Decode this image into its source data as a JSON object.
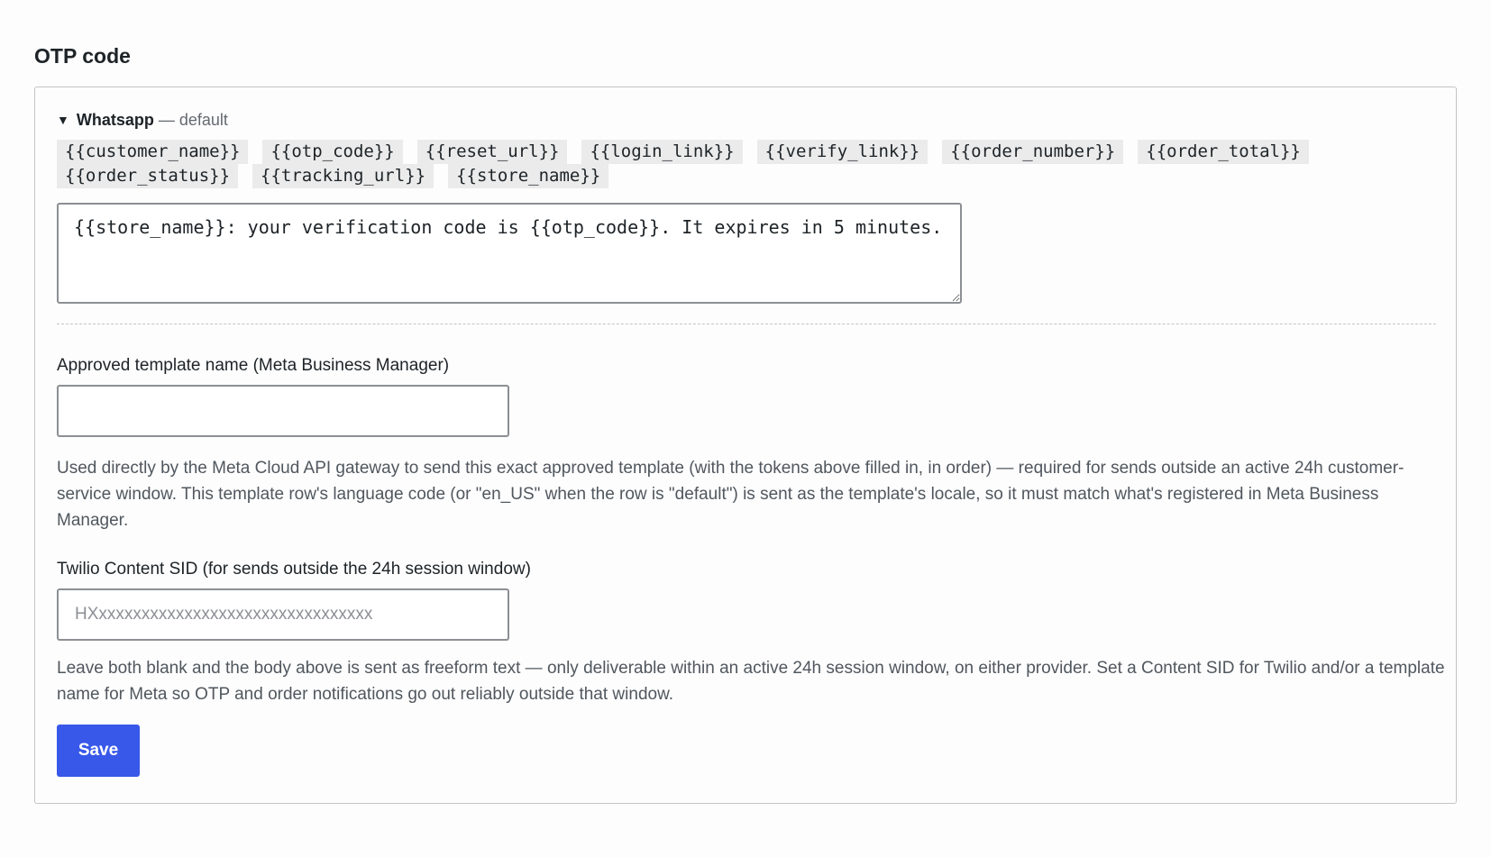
{
  "section": {
    "title": "OTP code"
  },
  "template_row": {
    "channel": "Whatsapp",
    "separator": "—",
    "locale": "default",
    "tokens": [
      "{{customer_name}}",
      "{{otp_code}}",
      "{{reset_url}}",
      "{{login_link}}",
      "{{verify_link}}",
      "{{order_number}}",
      "{{order_total}}",
      "{{order_status}}",
      "{{tracking_url}}",
      "{{store_name}}"
    ],
    "body_value": "{{store_name}}: your verification code is {{otp_code}}. It expires in 5 minutes."
  },
  "meta_template": {
    "label": "Approved template name (Meta Business Manager)",
    "value": "",
    "placeholder": "",
    "help": "Used directly by the Meta Cloud API gateway to send this exact approved template (with the tokens above filled in, in order) — required for sends outside an active 24h customer-service window. This template row's language code (or \"en_US\" when the row is \"default\") is sent as the template's locale, so it must match what's registered in Meta Business Manager."
  },
  "twilio_sid": {
    "label": "Twilio Content SID (for sends outside the 24h session window)",
    "value": "",
    "placeholder": "HXxxxxxxxxxxxxxxxxxxxxxxxxxxxxxxxx",
    "help": "Leave both blank and the body above is sent as freeform text — only deliverable within an active 24h session window, on either provider. Set a Content SID for Twilio and/or a template name for Meta so OTP and order notifications go out reliably outside that window."
  },
  "actions": {
    "save_label": "Save"
  },
  "colors": {
    "primary_button": "#3858e9",
    "token_background": "#ebebeb",
    "border": "#c3c4c7",
    "help_text": "#50575e"
  },
  "icons": {
    "disclosure": "triangle-down-icon"
  }
}
